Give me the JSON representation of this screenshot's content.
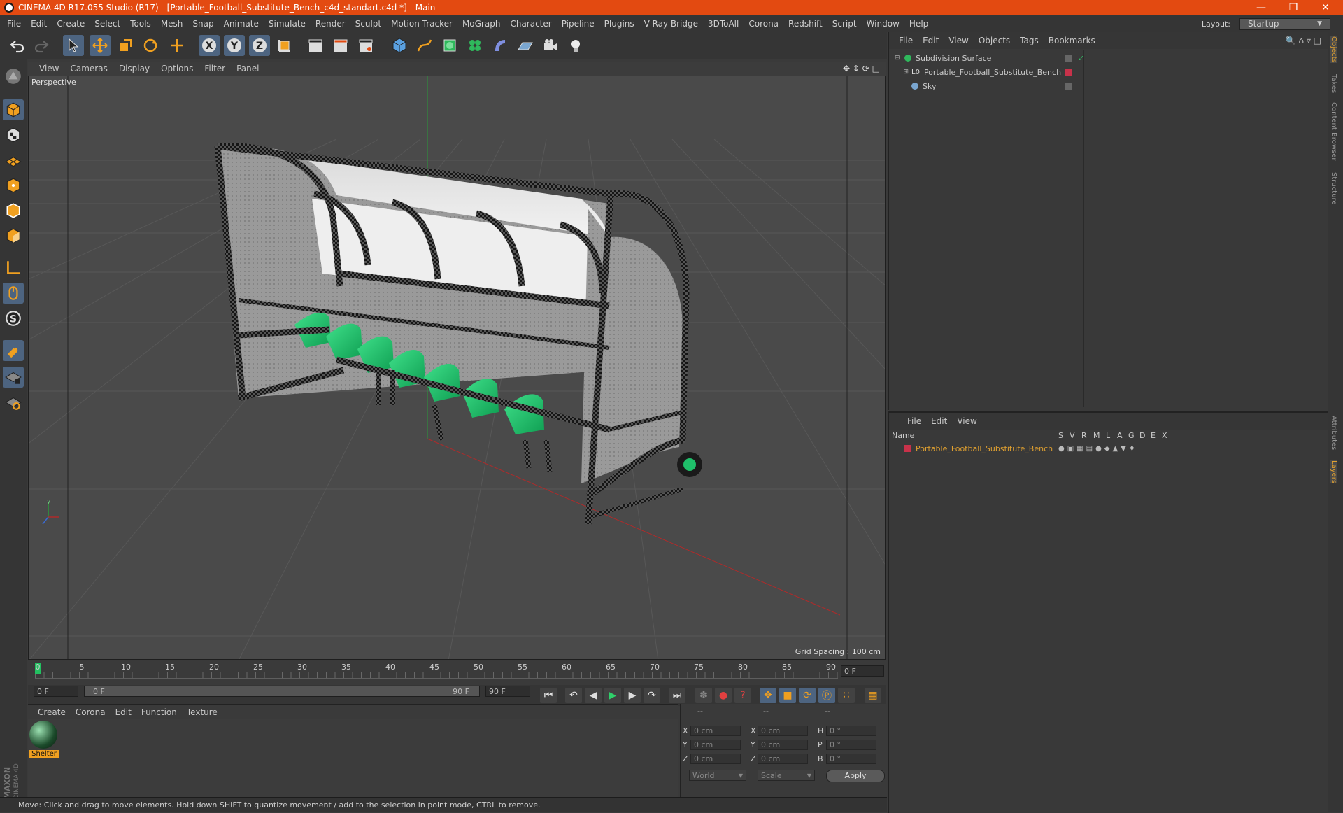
{
  "window": {
    "title": "CINEMA 4D R17.055 Studio (R17) - [Portable_Football_Substitute_Bench_c4d_standart.c4d *] - Main"
  },
  "menubar": {
    "items": [
      "File",
      "Edit",
      "Create",
      "Select",
      "Tools",
      "Mesh",
      "Snap",
      "Animate",
      "Simulate",
      "Render",
      "Sculpt",
      "Motion Tracker",
      "MoGraph",
      "Character",
      "Pipeline",
      "Plugins",
      "V-Ray Bridge",
      "3DToAll",
      "Corona",
      "Redshift",
      "Script",
      "Window",
      "Help"
    ],
    "layout_label": "Layout:",
    "layout_value": "Startup"
  },
  "viewport": {
    "menu": [
      "View",
      "Cameras",
      "Display",
      "Options",
      "Filter",
      "Panel"
    ],
    "label": "Perspective",
    "grid_spacing": "Grid Spacing : 100 cm"
  },
  "timeline": {
    "ticks": [
      "0",
      "5",
      "10",
      "15",
      "20",
      "25",
      "30",
      "35",
      "40",
      "45",
      "50",
      "55",
      "60",
      "65",
      "70",
      "75",
      "80",
      "85",
      "90"
    ],
    "current_frame": "0 F",
    "start_field": "0 F",
    "range_start": "0 F",
    "range_end": "90 F",
    "end_field": "90 F"
  },
  "material_manager": {
    "menu": [
      "Create",
      "Corona",
      "Edit",
      "Function",
      "Texture"
    ],
    "materials": [
      {
        "name": "Shelter"
      }
    ]
  },
  "coordinates": {
    "headers": [
      "--",
      "--",
      "--"
    ],
    "rows": [
      {
        "a": "X",
        "av": "0 cm",
        "b": "X",
        "bv": "0 cm",
        "c": "H",
        "cv": "0 °"
      },
      {
        "a": "Y",
        "av": "0 cm",
        "b": "Y",
        "bv": "0 cm",
        "c": "P",
        "cv": "0 °"
      },
      {
        "a": "Z",
        "av": "0 cm",
        "b": "Z",
        "bv": "0 cm",
        "c": "B",
        "cv": "0 °"
      }
    ],
    "mode": "World",
    "transform": "Scale",
    "apply": "Apply"
  },
  "object_manager": {
    "menu": [
      "File",
      "Edit",
      "View",
      "Objects",
      "Tags",
      "Bookmarks"
    ],
    "objects": [
      {
        "name": "Subdivision Surface",
        "icon": "subdivision-icon"
      },
      {
        "name": "Portable_Football_Substitute_Bench",
        "icon": "null-icon"
      },
      {
        "name": "Sky",
        "icon": "sky-icon"
      }
    ]
  },
  "layer_manager": {
    "menu": [
      "File",
      "Edit",
      "View"
    ],
    "columns": [
      "Name",
      "S",
      "V",
      "R",
      "M",
      "L",
      "A",
      "G",
      "D",
      "E",
      "X"
    ],
    "layers": [
      {
        "name": "Portable_Football_Substitute_Bench",
        "color": "#c8324a"
      }
    ]
  },
  "side_tabs": [
    "Objects",
    "Takes",
    "Content Browser",
    "Structure",
    "Attributes",
    "Layers"
  ],
  "status": "Move: Click and drag to move elements. Hold down SHIFT to quantize movement / add to the selection in point mode, CTRL to remove.",
  "brand": "MAXON CINEMA 4D",
  "colors": {
    "titlebar": "#e34a11",
    "selection": "#4d6480",
    "seat_green": "#1fbf6a",
    "layer_text": "#e0a030"
  }
}
